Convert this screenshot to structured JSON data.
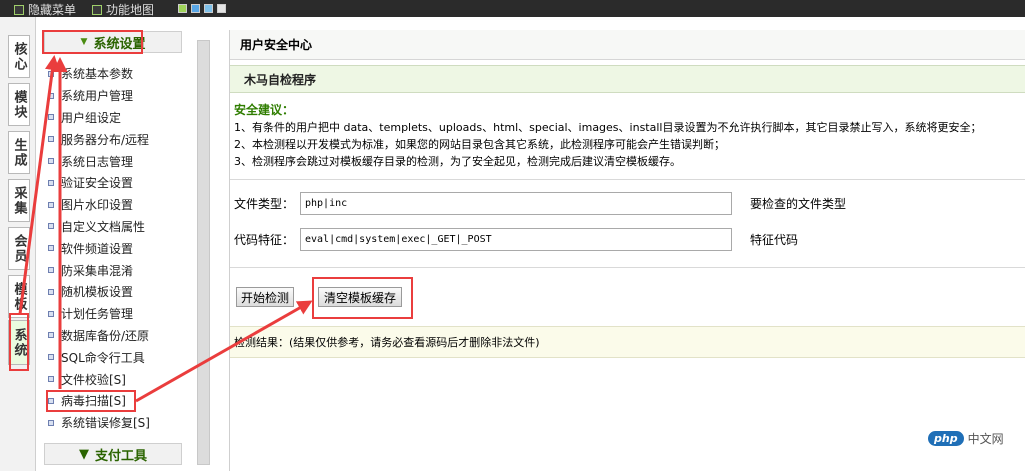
{
  "topbar": {
    "hide_menu": "隐藏菜单",
    "function_map": "功能地图"
  },
  "vtabs": [
    "核心",
    "模块",
    "生成",
    "采集",
    "会员",
    "模板",
    "系统"
  ],
  "menu": {
    "header": "系统设置",
    "items": [
      "系统基本参数",
      "系统用户管理",
      "用户组设定",
      "服务器分布/远程",
      "系统日志管理",
      "验证安全设置",
      "图片水印设置",
      "自定义文档属性",
      "软件频道设置",
      "防采集串混淆",
      "随机模板设置",
      "计划任务管理",
      "数据库备份/还原",
      "SQL命令行工具",
      "文件校验[S]",
      "病毒扫描[S]",
      "系统错误修复[S]"
    ],
    "footer": "支付工具"
  },
  "main": {
    "page_title": "用户安全中心",
    "panel_title": "木马自检程序",
    "advice_head": "安全建议：",
    "advice_lines": [
      "1、有条件的用户把中 data、templets、uploads、html、special、images、install目录设置为不允许执行脚本，其它目录禁止写入，系统将更安全；",
      "2、本检测程以开发模式为标准，如果您的网站目录包含其它系统，此检测程序可能会产生错误判断；",
      "3、检测程序会跳过对模板缓存目录的检测，为了安全起见，检测完成后建议清空模板缓存。"
    ],
    "file_type_label": "文件类型：",
    "file_type_value": "php|inc",
    "file_type_hint": "要检查的文件类型",
    "code_label": "代码特征：",
    "code_value": "eval|cmd|system|exec|_GET|_POST",
    "code_hint": "特征代码",
    "start_button": "开始检测",
    "clear_button": "清空模板缓存",
    "result_text": "检测结果：(结果仅供参考，请务必查看源码后才删除非法文件)"
  },
  "watermark": {
    "badge": "php",
    "text": "中文网"
  },
  "colors": {
    "annotation": "#ea3d3d",
    "accent_green": "#2a6300"
  }
}
